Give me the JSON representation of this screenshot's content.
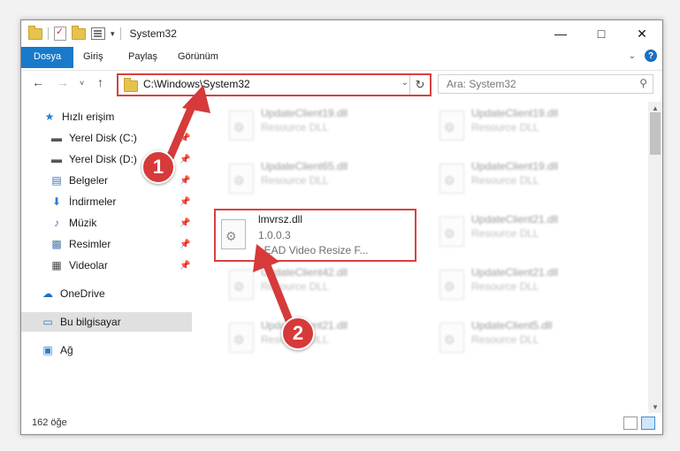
{
  "window": {
    "title": "System32"
  },
  "ribbon": {
    "tabs": [
      {
        "label": "Dosya"
      },
      {
        "label": "Giriş"
      },
      {
        "label": "Paylaş"
      },
      {
        "label": "Görünüm"
      }
    ]
  },
  "nav": {
    "address": "C:\\Windows\\System32",
    "search_placeholder": "Ara: System32"
  },
  "sidebar": {
    "items": [
      {
        "label": "Hızlı erişim",
        "icon": "star-icon"
      },
      {
        "label": "Yerel Disk (C:)",
        "icon": "drive-icon",
        "pinned": true
      },
      {
        "label": "Yerel Disk (D:)",
        "icon": "drive-icon",
        "pinned": true
      },
      {
        "label": "Belgeler",
        "icon": "documents-icon",
        "pinned": true
      },
      {
        "label": "İndirmeler",
        "icon": "download-icon",
        "pinned": true
      },
      {
        "label": "Müzik",
        "icon": "music-icon",
        "pinned": true
      },
      {
        "label": "Resimler",
        "icon": "pictures-icon",
        "pinned": true
      },
      {
        "label": "Videolar",
        "icon": "video-icon",
        "pinned": true
      },
      {
        "label": "OneDrive",
        "icon": "cloud-icon"
      },
      {
        "label": "Bu bilgisayar",
        "icon": "computer-icon",
        "selected": true
      },
      {
        "label": "Ağ",
        "icon": "network-icon"
      }
    ]
  },
  "files": [
    {
      "name": "UpdateClient19.dll",
      "desc": "Resource DLL"
    },
    {
      "name": "UpdateClient19.dll",
      "desc": "Resource DLL"
    },
    {
      "name": "UpdateClient65.dll",
      "desc": "Resource DLL"
    },
    {
      "name": "UpdateClient19.dll",
      "desc": "Resource DLL"
    },
    {
      "name": "lmvrsz.dll",
      "version": "1.0.0.3",
      "desc": "LEAD Video Resize F..."
    },
    {
      "name": "UpdateClient21.dll",
      "desc": "Resource DLL"
    },
    {
      "name": "UpdateClient42.dll",
      "desc": "Resource DLL"
    },
    {
      "name": "UpdateClient21.dll",
      "desc": "Resource DLL"
    },
    {
      "name": "UpdateClient21.dll",
      "desc": "Resource DLL"
    },
    {
      "name": "UpdateClient5.dll",
      "desc": "Resource DLL"
    }
  ],
  "status": {
    "count": "162 öğe"
  },
  "annotations": {
    "step1": "1",
    "step2": "2",
    "color": "#d63a3a"
  }
}
